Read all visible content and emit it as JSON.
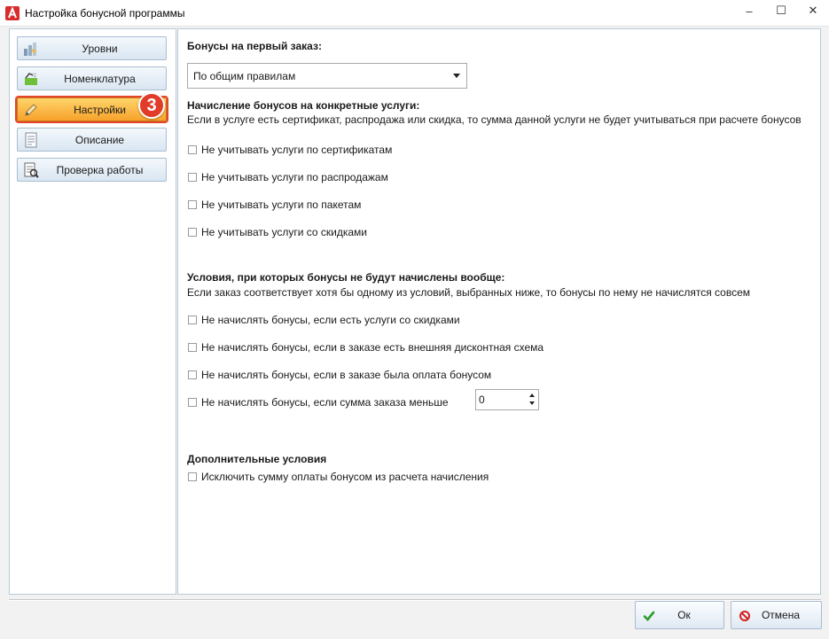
{
  "window": {
    "title": "Настройка бонусной программы",
    "controls": {
      "minimize": "–",
      "maximize": "☐",
      "close": "✕"
    }
  },
  "nav": {
    "items": [
      {
        "label": "Уровни",
        "icon": "levels-icon"
      },
      {
        "label": "Номенклатура",
        "icon": "catalog-icon"
      },
      {
        "label": "Настройки",
        "icon": "settings-pencil-icon",
        "active": true
      },
      {
        "label": "Описание",
        "icon": "document-icon"
      },
      {
        "label": "Проверка работы",
        "icon": "check-report-icon"
      }
    ],
    "step_badge": "3"
  },
  "first_order": {
    "heading": "Бонусы на первый заказ:",
    "selected": "По общим правилам"
  },
  "services": {
    "heading": "Начисление бонусов на конкретные услуги:",
    "description": "Если в услуге есть сертификат, распродажа или скидка, то сумма данной услуги не будет учитываться при расчете бонусов",
    "options": [
      {
        "label": "Не учитывать услуги по сертификатам",
        "checked": false
      },
      {
        "label": "Не учитывать услуги по распродажам",
        "checked": false
      },
      {
        "label": "Не учитывать услуги по пакетам",
        "checked": false
      },
      {
        "label": "Не учитывать услуги со скидками",
        "checked": false
      }
    ]
  },
  "conditions": {
    "heading": "Условия, при которых бонусы не будут начислены вообще:",
    "description": "Если заказ соответствует хотя бы одному из условий, выбранных ниже, то бонусы по нему не начислятся совсем",
    "options": [
      {
        "label": "Не начислять бонусы, если есть услуги со скидками",
        "checked": false
      },
      {
        "label": "Не начислять бонусы, если в заказе есть внешняя дисконтная схема",
        "checked": false
      },
      {
        "label": "Не начислять бонусы, если в заказе была оплата бонусом",
        "checked": false
      },
      {
        "label": "Не начислять бонусы, если сумма заказа меньше",
        "checked": false
      }
    ],
    "min_amount": "0"
  },
  "additional": {
    "heading": "Дополнительные условия",
    "options": [
      {
        "label": "Исключить сумму оплаты бонусом из расчета начисления",
        "checked": false
      }
    ]
  },
  "footer": {
    "ok_label": "Ок",
    "cancel_label": "Отмена"
  },
  "colors": {
    "accent_active": "#f7a22a",
    "badge": "#e13b2a",
    "ok_icon": "#2e9b2e",
    "cancel_icon": "#d52020"
  }
}
